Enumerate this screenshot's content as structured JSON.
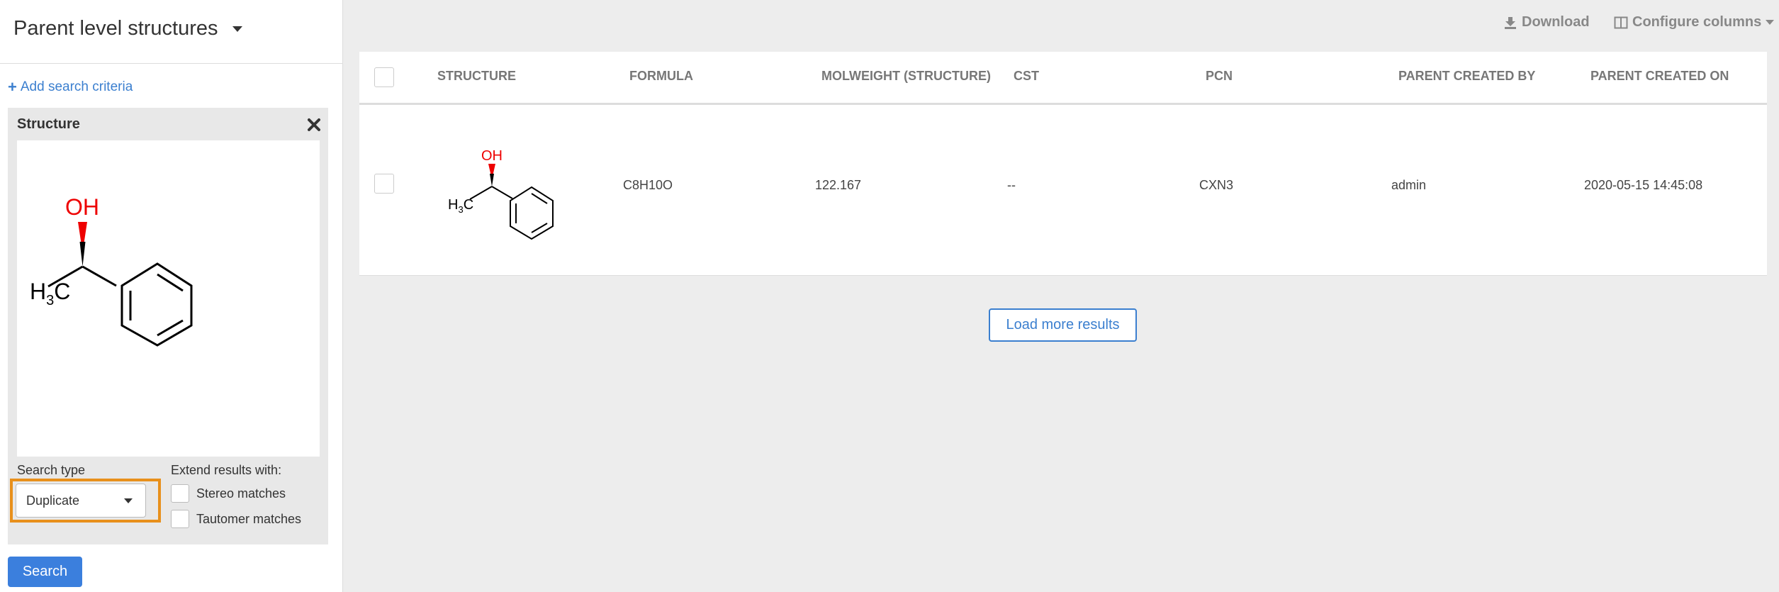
{
  "sidebar": {
    "title": "Parent level structures",
    "add_criteria_label": "Add search criteria",
    "criteria": {
      "title": "Structure",
      "molecule": {
        "atoms": {
          "oh": "OH",
          "ch3_h": "H",
          "ch3_sub": "3",
          "ch3_c": "C"
        },
        "colors": {
          "oxygen": "#ee0000"
        }
      },
      "search_type_label": "Search type",
      "search_type_value": "Duplicate",
      "extend_label": "Extend results with:",
      "options": [
        {
          "label": "Stereo matches"
        },
        {
          "label": "Tautomer matches"
        }
      ]
    },
    "search_button": "Search"
  },
  "toolbar": {
    "download_label": "Download",
    "configure_label": "Configure columns"
  },
  "table": {
    "headers": {
      "structure": "STRUCTURE",
      "formula": "FORMULA",
      "molweight": "MOLWEIGHT (STRUCTURE)",
      "cst": "CST",
      "pcn": "PCN",
      "created_by": "PARENT CREATED BY",
      "created_on": "PARENT CREATED ON"
    },
    "rows": [
      {
        "formula": "C8H10O",
        "molweight": "122.167",
        "cst": "--",
        "pcn": "CXN3",
        "created_by": "admin",
        "created_on": "2020-05-15 14:45:08"
      }
    ]
  },
  "load_more": "Load more results",
  "colors": {
    "accent": "#3b7fdd",
    "highlight": "#e8901c"
  }
}
